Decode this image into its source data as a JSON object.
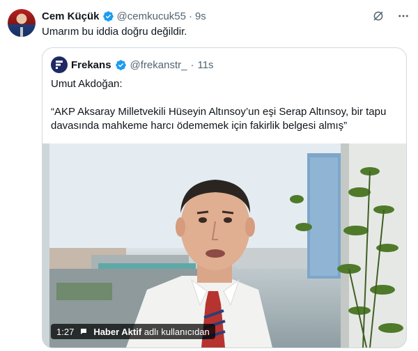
{
  "tweet": {
    "author_name": "Cem Küçük",
    "handle": "@cemkucuk55",
    "separator": "·",
    "time": "9s",
    "text": "Umarım bu iddia doğru değildir."
  },
  "quoted_tweet": {
    "author_name": "Frekans",
    "handle": "@frekanstr_",
    "separator": "·",
    "time": "11s",
    "speaker": "Umut Akdoğan:",
    "quote": "“AKP Aksaray Milletvekili Hüseyin Altınsoy’un eşi Serap Altınsoy, bir tapu davasında mahkeme harcı ödememek için fakirlik belgesi almış”"
  },
  "video": {
    "duration": "1:27",
    "channel": "Haber Aktif",
    "attribution": "adlı kullanıcıdan"
  },
  "icons": [
    "verified-badge-icon",
    "grok-slash-icon",
    "more-icon",
    "video-comment-icon"
  ],
  "colors": {
    "verified": "#1d9bf0",
    "muted": "#536471",
    "border": "#cfd9de"
  }
}
